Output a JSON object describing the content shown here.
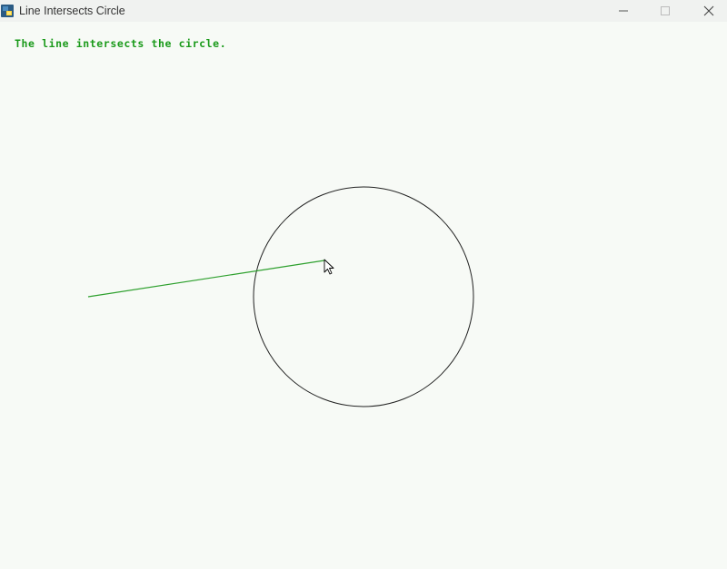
{
  "window": {
    "title": "Line Intersects Circle",
    "app_icon": "python-icon"
  },
  "controls": {
    "minimize_icon": "minimize-icon",
    "maximize_icon": "maximize-icon",
    "close_icon": "close-icon"
  },
  "canvas": {
    "status_message": "The line intersects the circle.",
    "status_color": "#1a9a1a",
    "line_color": "#2ea02e",
    "circle_color": "#222222",
    "background_color": "#f7faf6",
    "cursor_icon": "mouse-pointer-icon"
  }
}
